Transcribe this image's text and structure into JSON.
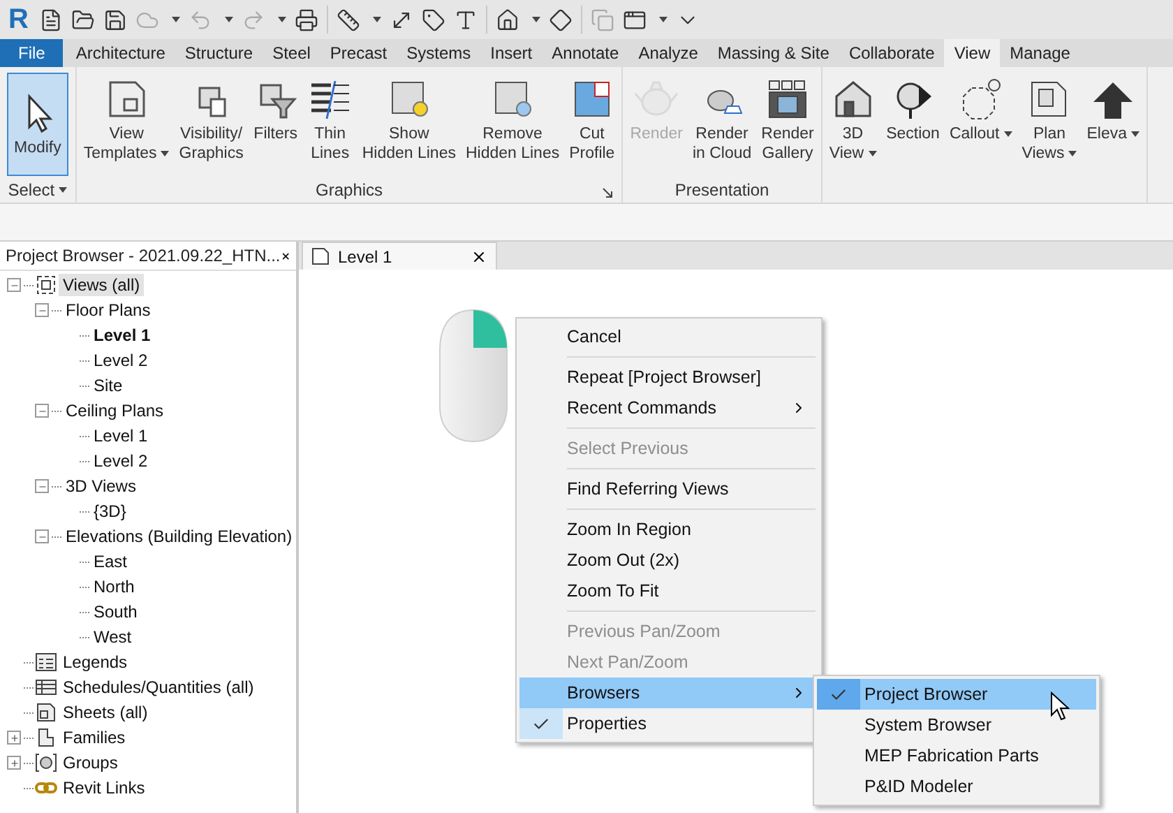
{
  "app_logo": "R",
  "ribbon_tabs": [
    {
      "label": "File",
      "kind": "file",
      "selected": false
    },
    {
      "label": "Architecture",
      "kind": "tab",
      "selected": false
    },
    {
      "label": "Structure",
      "kind": "tab",
      "selected": false
    },
    {
      "label": "Steel",
      "kind": "tab",
      "selected": false
    },
    {
      "label": "Precast",
      "kind": "tab",
      "selected": false
    },
    {
      "label": "Systems",
      "kind": "tab",
      "selected": false
    },
    {
      "label": "Insert",
      "kind": "tab",
      "selected": false
    },
    {
      "label": "Annotate",
      "kind": "tab",
      "selected": false
    },
    {
      "label": "Analyze",
      "kind": "tab",
      "selected": false
    },
    {
      "label": "Massing & Site",
      "kind": "tab",
      "selected": false
    },
    {
      "label": "Collaborate",
      "kind": "tab",
      "selected": false
    },
    {
      "label": "View",
      "kind": "tab",
      "selected": true
    },
    {
      "label": "Manage",
      "kind": "tab",
      "selected": false
    }
  ],
  "ribbon_panels": [
    {
      "title": "Select",
      "title_dropdown": true,
      "launcher": false,
      "buttons": [
        {
          "label": "Modify",
          "selected": true,
          "disabled": false,
          "dropdown": false
        }
      ]
    },
    {
      "title": "Graphics",
      "title_dropdown": false,
      "launcher": true,
      "buttons": [
        {
          "label": "View\nTemplates",
          "selected": false,
          "disabled": false,
          "dropdown": true
        },
        {
          "label": "Visibility/\nGraphics",
          "selected": false,
          "disabled": false,
          "dropdown": false
        },
        {
          "label": "Filters",
          "selected": false,
          "disabled": false,
          "dropdown": false
        },
        {
          "label": "Thin\nLines",
          "selected": false,
          "disabled": false,
          "dropdown": false
        },
        {
          "label": "Show\nHidden Lines",
          "selected": false,
          "disabled": false,
          "dropdown": false
        },
        {
          "label": "Remove\nHidden Lines",
          "selected": false,
          "disabled": false,
          "dropdown": false
        },
        {
          "label": "Cut\nProfile",
          "selected": false,
          "disabled": false,
          "dropdown": false
        }
      ]
    },
    {
      "title": "Presentation",
      "title_dropdown": false,
      "launcher": false,
      "buttons": [
        {
          "label": "Render",
          "selected": false,
          "disabled": true,
          "dropdown": false
        },
        {
          "label": "Render\nin Cloud",
          "selected": false,
          "disabled": false,
          "dropdown": false
        },
        {
          "label": "Render\nGallery",
          "selected": false,
          "disabled": false,
          "dropdown": false
        }
      ]
    },
    {
      "buttons": [
        {
          "label": "3D\nView",
          "selected": false,
          "disabled": false,
          "dropdown": true
        },
        {
          "label": "Section",
          "selected": false,
          "disabled": false,
          "dropdown": false
        },
        {
          "label": "Callout",
          "selected": false,
          "disabled": false,
          "dropdown": true
        },
        {
          "label": "Plan\nViews",
          "selected": false,
          "disabled": false,
          "dropdown": true
        },
        {
          "label": "Eleva",
          "selected": false,
          "disabled": false,
          "dropdown": true
        }
      ]
    }
  ],
  "project_browser": {
    "title": "Project Browser - 2021.09.22_HTN...",
    "tree": [
      {
        "label": "Views (all)",
        "kind": "views",
        "expanded": true,
        "selected": true,
        "current": false,
        "children": [
          {
            "label": "Floor Plans",
            "expanded": true,
            "selected": false,
            "current": false,
            "children": [
              {
                "label": "Level 1",
                "selected": false,
                "current": true
              },
              {
                "label": "Level 2",
                "selected": false,
                "current": false
              },
              {
                "label": "Site",
                "selected": false,
                "current": false
              }
            ]
          },
          {
            "label": "Ceiling Plans",
            "expanded": true,
            "selected": false,
            "current": false,
            "children": [
              {
                "label": "Level 1",
                "selected": false,
                "current": false
              },
              {
                "label": "Level 2",
                "selected": false,
                "current": false
              }
            ]
          },
          {
            "label": "3D Views",
            "expanded": true,
            "selected": false,
            "current": false,
            "children": [
              {
                "label": "{3D}",
                "selected": false,
                "current": false
              }
            ]
          },
          {
            "label": "Elevations (Building Elevation)",
            "expanded": true,
            "selected": false,
            "current": false,
            "children": [
              {
                "label": "East",
                "selected": false,
                "current": false
              },
              {
                "label": "North",
                "selected": false,
                "current": false
              },
              {
                "label": "South",
                "selected": false,
                "current": false
              },
              {
                "label": "West",
                "selected": false,
                "current": false
              }
            ]
          }
        ]
      },
      {
        "label": "Legends",
        "kind": "legends",
        "selected": false,
        "current": false
      },
      {
        "label": "Schedules/Quantities (all)",
        "kind": "schedules",
        "selected": false,
        "current": false
      },
      {
        "label": "Sheets (all)",
        "kind": "sheets",
        "selected": false,
        "current": false
      },
      {
        "label": "Families",
        "kind": "families",
        "expanded": false,
        "selected": false,
        "current": false
      },
      {
        "label": "Groups",
        "kind": "groups",
        "expanded": false,
        "selected": false,
        "current": false
      },
      {
        "label": "Revit Links",
        "kind": "links",
        "selected": false,
        "current": false
      }
    ]
  },
  "view_tab": {
    "title": "Level 1"
  },
  "context_menu": {
    "items": [
      {
        "kind": "item",
        "label": "Cancel",
        "disabled": false,
        "checked": false,
        "submenu": false,
        "selected": false
      },
      {
        "kind": "separator"
      },
      {
        "kind": "item",
        "label": "Repeat [Project Browser]",
        "disabled": false,
        "checked": false,
        "submenu": false,
        "selected": false
      },
      {
        "kind": "item",
        "label": "Recent Commands",
        "disabled": false,
        "checked": false,
        "submenu": true,
        "selected": false
      },
      {
        "kind": "separator"
      },
      {
        "kind": "item",
        "label": "Select Previous",
        "disabled": true,
        "checked": false,
        "submenu": false,
        "selected": false
      },
      {
        "kind": "separator"
      },
      {
        "kind": "item",
        "label": "Find Referring Views",
        "disabled": false,
        "checked": false,
        "submenu": false,
        "selected": false
      },
      {
        "kind": "separator"
      },
      {
        "kind": "item",
        "label": "Zoom In Region",
        "disabled": false,
        "checked": false,
        "submenu": false,
        "selected": false
      },
      {
        "kind": "item",
        "label": "Zoom Out (2x)",
        "disabled": false,
        "checked": false,
        "submenu": false,
        "selected": false
      },
      {
        "kind": "item",
        "label": "Zoom To Fit",
        "disabled": false,
        "checked": false,
        "submenu": false,
        "selected": false
      },
      {
        "kind": "separator"
      },
      {
        "kind": "item",
        "label": "Previous Pan/Zoom",
        "disabled": true,
        "checked": false,
        "submenu": false,
        "selected": false
      },
      {
        "kind": "item",
        "label": "Next Pan/Zoom",
        "disabled": true,
        "checked": false,
        "submenu": false,
        "selected": false
      },
      {
        "kind": "item",
        "label": "Browsers",
        "disabled": false,
        "checked": false,
        "submenu": true,
        "selected": true
      },
      {
        "kind": "item",
        "label": "Properties",
        "disabled": false,
        "checked": true,
        "submenu": false,
        "selected": false
      }
    ]
  },
  "submenu": {
    "items": [
      {
        "label": "Project Browser",
        "checked": true,
        "selected": true
      },
      {
        "label": "System Browser",
        "checked": false,
        "selected": false
      },
      {
        "label": "MEP Fabrication Parts",
        "checked": false,
        "selected": false
      },
      {
        "label": "P&ID Modeler",
        "checked": false,
        "selected": false
      }
    ]
  }
}
